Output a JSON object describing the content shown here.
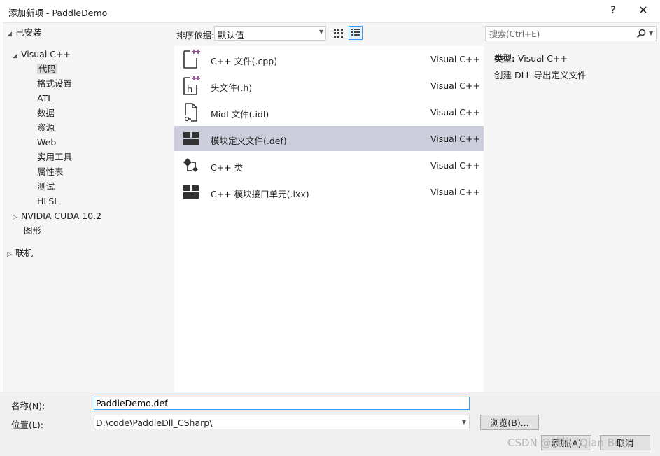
{
  "window": {
    "title": "添加新项 - PaddleDemo",
    "help_label": "?",
    "close_label": "✕"
  },
  "tree": {
    "installed": "已安装",
    "visual_cpp": "Visual C++",
    "children": [
      "代码",
      "格式设置",
      "ATL",
      "数据",
      "资源",
      "Web",
      "实用工具",
      "属性表",
      "测试",
      "HLSL"
    ],
    "nvidia": "NVIDIA CUDA 10.2",
    "graphics": "图形",
    "online": "联机"
  },
  "toolbar": {
    "sort_label": "排序依据:",
    "sort_value": "默认值"
  },
  "search": {
    "placeholder": "搜索(Ctrl+E)"
  },
  "templates": [
    {
      "name": "C++ 文件(.cpp)",
      "type": "Visual C++",
      "icon": "cpp-file-icon"
    },
    {
      "name": "头文件(.h)",
      "type": "Visual C++",
      "icon": "header-file-icon"
    },
    {
      "name": "Midl 文件(.idl)",
      "type": "Visual C++",
      "icon": "idl-file-icon"
    },
    {
      "name": "模块定义文件(.def)",
      "type": "Visual C++",
      "icon": "module-def-icon"
    },
    {
      "name": "C++ 类",
      "type": "Visual C++",
      "icon": "cpp-class-icon"
    },
    {
      "name": "C++ 模块接口单元(.ixx)",
      "type": "Visual C++",
      "icon": "module-interface-icon"
    }
  ],
  "details": {
    "type_label": "类型:",
    "type_value": "Visual C++",
    "description": "创建 DLL 导出定义文件"
  },
  "form": {
    "name_label": "名称(N):",
    "name_value": "PaddleDemo.def",
    "location_label": "位置(L):",
    "location_value": "D:\\code\\PaddleDll_CSharp\\",
    "browse_label": "浏览(B)...",
    "add_label": "添加(A)",
    "cancel_label": "取消"
  },
  "watermark": "CSDN @钱彬 (Qian Bin)",
  "colors": {
    "selected_row": "#cccedb",
    "focus_border": "#3399ff",
    "list_bg": "#ffffff"
  }
}
